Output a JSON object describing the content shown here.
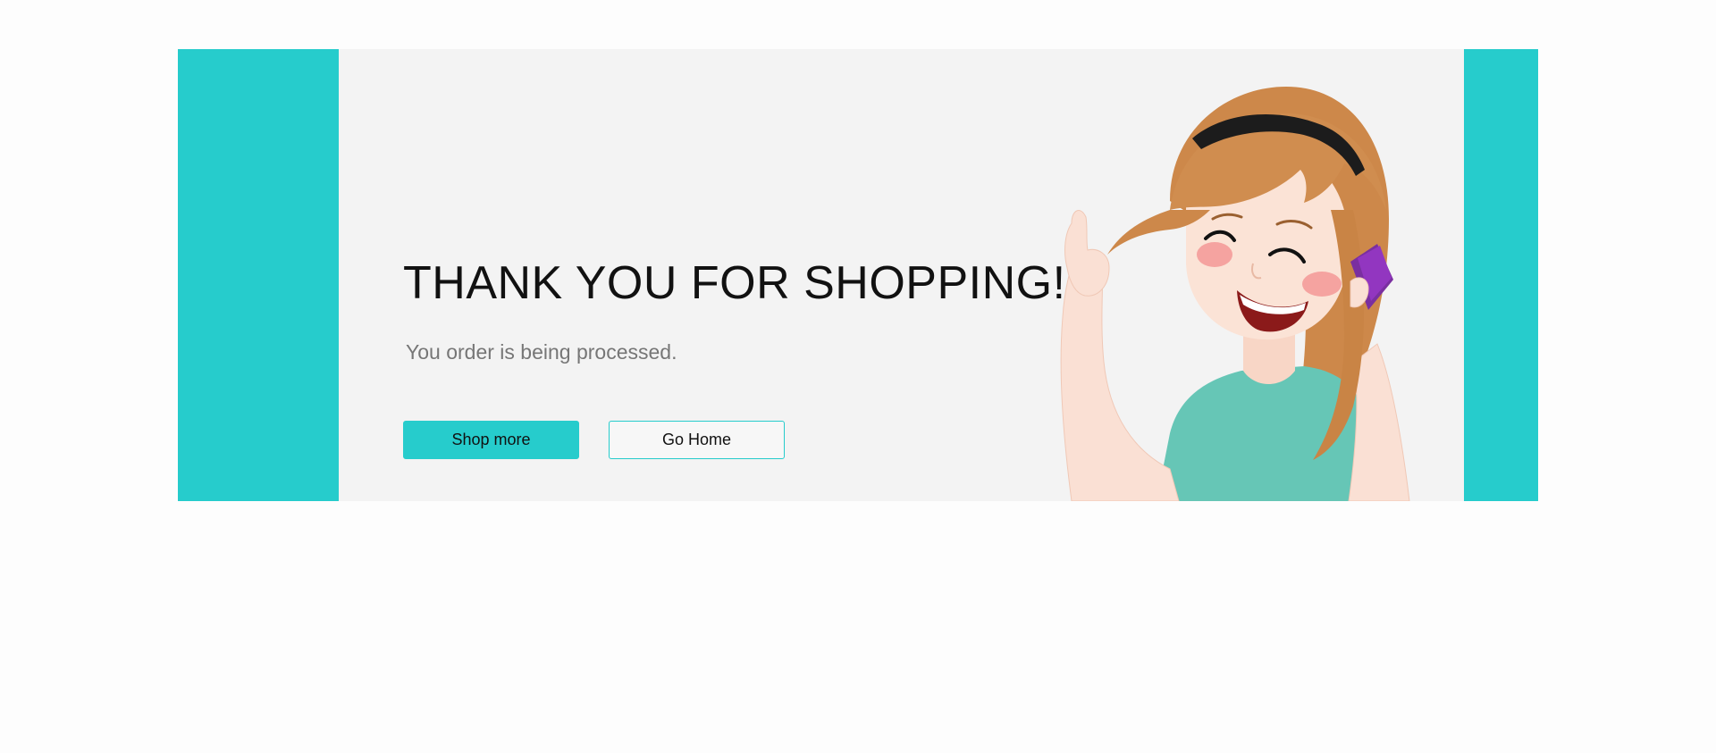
{
  "banner": {
    "title": "THANK YOU FOR SHOPPING!",
    "subtitle": "You order is being processed.",
    "buttons": {
      "shop_more": "Shop more",
      "go_home": "Go Home"
    },
    "illustration": "girl-on-phone-laughing",
    "colors": {
      "accent": "#26cccc",
      "panel_background": "#f3f3f3",
      "page_background": "#fdfdfd"
    }
  }
}
